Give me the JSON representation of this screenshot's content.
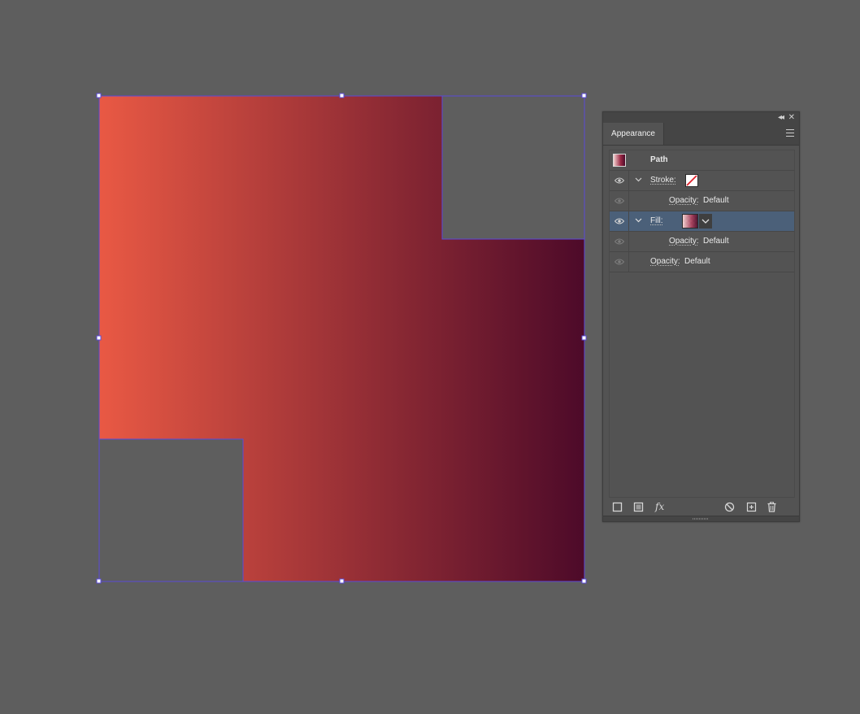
{
  "canvas": {
    "background_color": "#5e5e5e",
    "gradient_start_color": "#e95944",
    "gradient_end_color": "#4d0a29",
    "selection_color": "#5b4bd8"
  },
  "panel": {
    "tab_label": "Appearance",
    "rows": {
      "path_label": "Path",
      "stroke_label": "Stroke:",
      "stroke_opacity_label": "Opacity:",
      "stroke_opacity_value": "Default",
      "fill_label": "Fill:",
      "fill_opacity_label": "Opacity:",
      "fill_opacity_value": "Default",
      "object_opacity_label": "Opacity:",
      "object_opacity_value": "Default"
    },
    "icons": {
      "collapse": "double-chevron-left-icon",
      "close": "close-icon",
      "menu": "hamburger-menu-icon",
      "fx": "fx"
    },
    "selected_row_color": "#4b6079"
  }
}
